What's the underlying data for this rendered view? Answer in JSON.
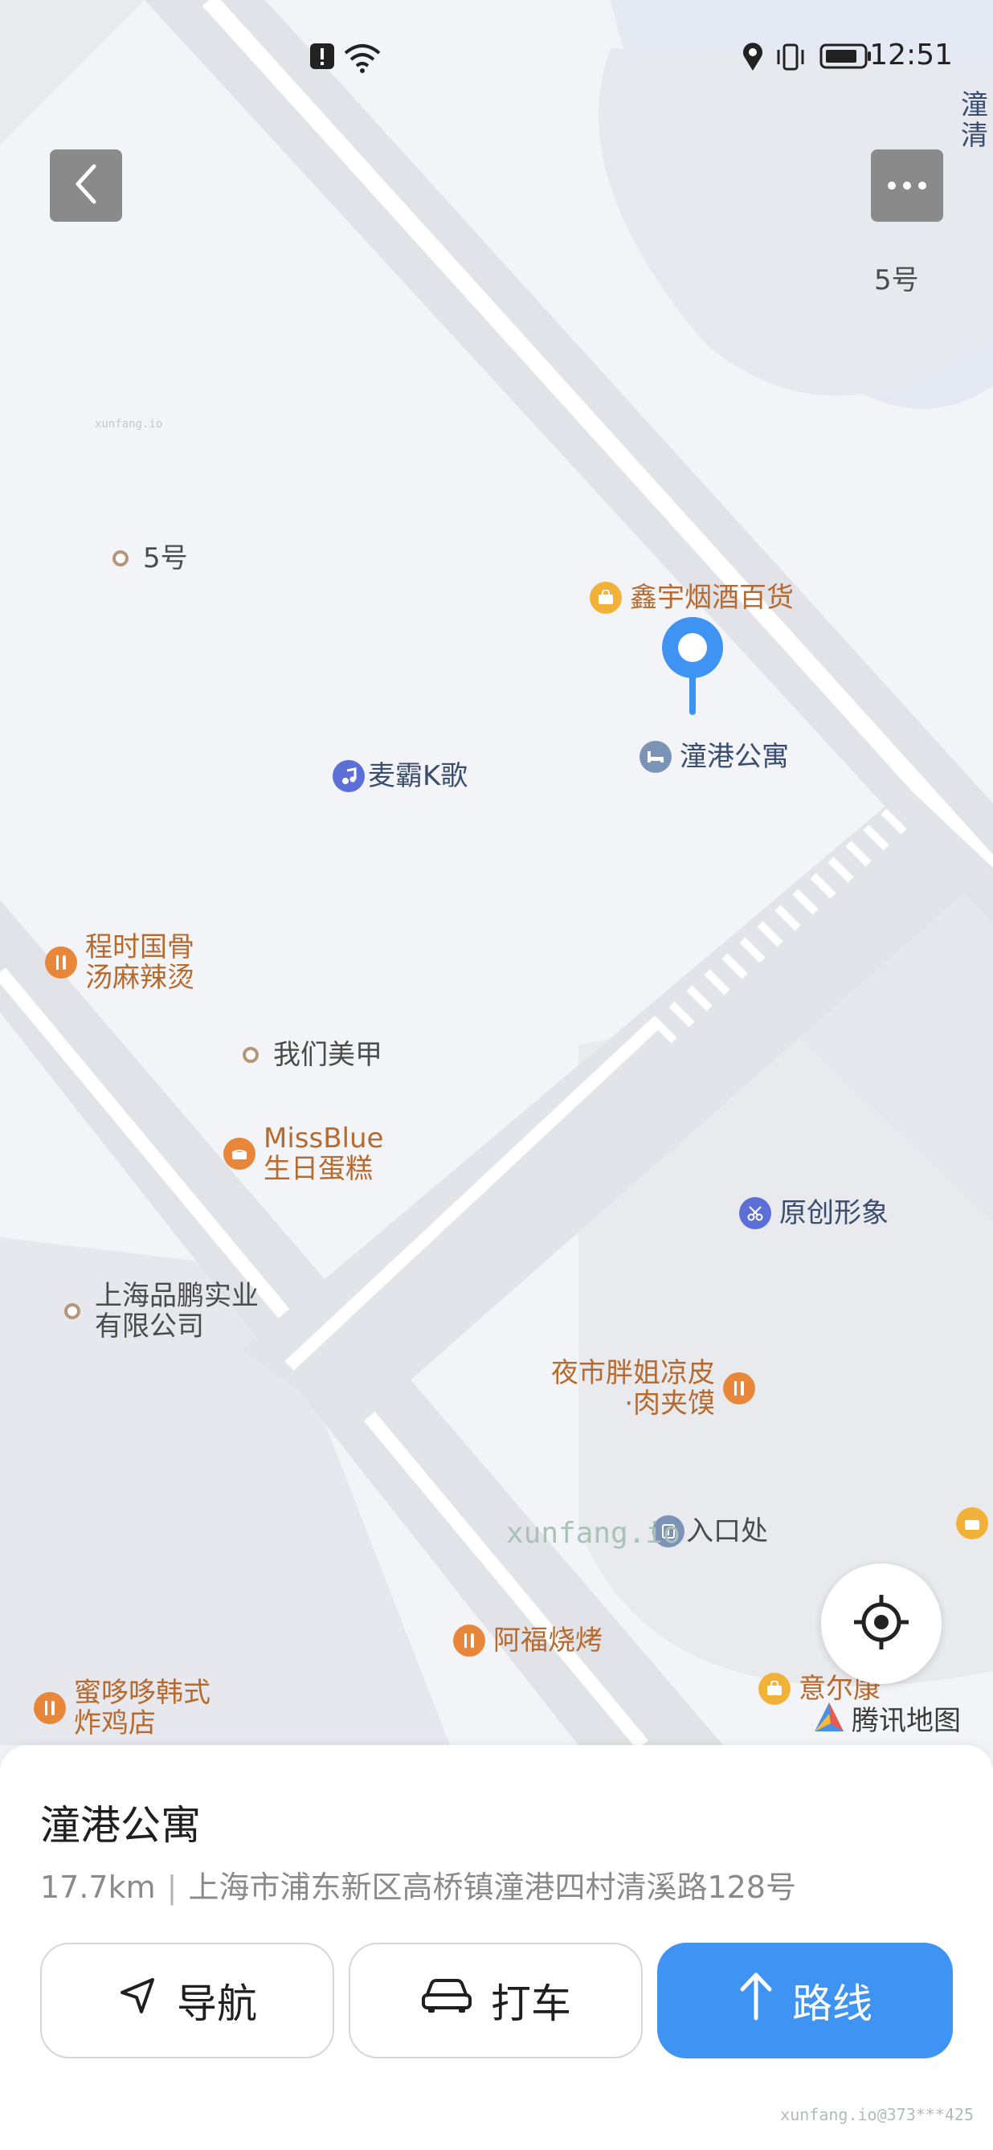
{
  "status_bar": {
    "time": "12:51"
  },
  "map": {
    "labels": {
      "no5_top": "5号",
      "no5_left": "5号",
      "xinyu": "鑫宇烟酒百货",
      "tonggang": "潼港公寓",
      "maiba": "麦霸K歌",
      "chengshi": "程时国骨\n汤麻辣烫",
      "women_meijia": "我们美甲",
      "missblue": "MissBlue\n生日蛋糕",
      "yuanchuang": "原创形象",
      "pinpeng": "上海品鹏实业\n有限公司",
      "yeshi": "夜市胖姐凉皮\n·肉夹馍",
      "entrance": "入口处",
      "afu": "阿福烧烤",
      "midodo": "蜜哆哆韩式\n炸鸡店",
      "yierkang": "意尔康",
      "edge_top": "潼\n清"
    },
    "brand": "腾讯地图",
    "watermark_center": "xunfang.io",
    "watermark_small": "xunfang.io"
  },
  "place": {
    "name": "潼港公寓",
    "distance": "17.7km",
    "separator": "|",
    "address": "上海市浦东新区高桥镇潼港四村清溪路128号"
  },
  "actions": {
    "navigate": "导航",
    "taxi": "打车",
    "route": "路线"
  },
  "footer_watermark": "xunfang.io@373***425",
  "icons": {
    "back": "chevron-left-icon",
    "more": "more-dots-icon",
    "locate": "locate-target-icon",
    "nav": "navigation-arrow-icon",
    "car": "car-icon",
    "route": "route-arrow-icon"
  },
  "colors": {
    "primary": "#3f93f2",
    "poi_orange": "#e8873a",
    "poi_yellow": "#f2b23a",
    "poi_blue": "#5b6fd6",
    "pin_blue": "#3f93f2"
  }
}
